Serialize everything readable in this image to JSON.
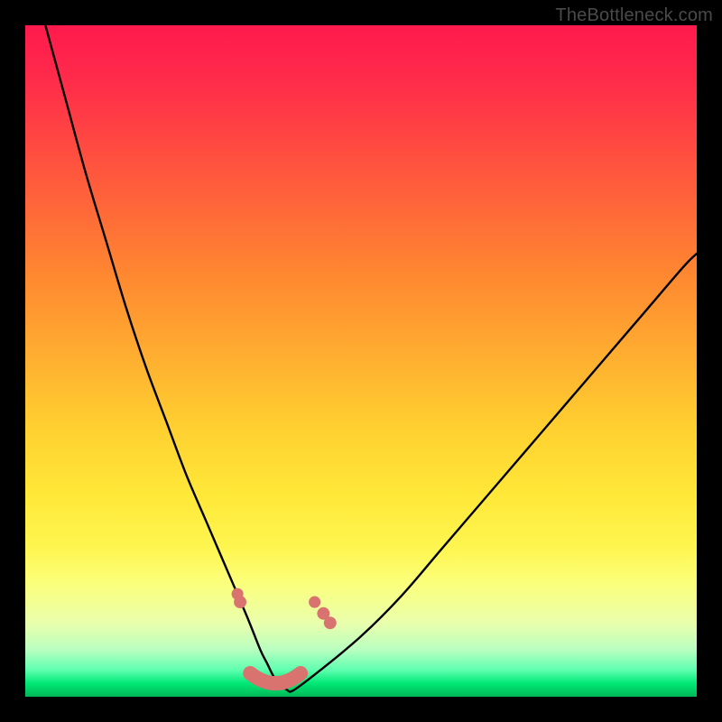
{
  "watermark": {
    "text": "TheBottleneck.com"
  },
  "colors": {
    "frame": "#000000",
    "curve": "#000000",
    "highlight_fill": "#d9736f",
    "highlight_stroke": "#d9736f",
    "gradient_top": "#ff1a4d",
    "gradient_bottom": "#00b857"
  },
  "chart_data": {
    "type": "line",
    "title": "",
    "xlabel": "",
    "ylabel": "",
    "xlim": [
      0,
      100
    ],
    "ylim": [
      0,
      100
    ],
    "grid": false,
    "legend": false,
    "series": [
      {
        "name": "bottleneck-curve",
        "x": [
          3,
          6,
          9,
          12,
          15,
          18,
          21,
          24,
          27,
          30,
          33,
          35,
          36,
          37,
          38,
          39,
          40,
          44,
          50,
          56,
          62,
          68,
          74,
          80,
          86,
          92,
          98,
          100
        ],
        "y": [
          100,
          89,
          78,
          68,
          58,
          49,
          41,
          33,
          26,
          19,
          12,
          7,
          5,
          3,
          2,
          1,
          1,
          4,
          9,
          15,
          22,
          29,
          36,
          43,
          50,
          57,
          64,
          66
        ]
      }
    ],
    "highlight_segments": [
      {
        "center_x": 31.6,
        "center_y": 15.3,
        "r": 1.6
      },
      {
        "center_x": 32.0,
        "center_y": 14.1,
        "r": 1.7
      },
      {
        "center_x": 43.1,
        "center_y": 14.1,
        "r": 1.6
      },
      {
        "center_x": 44.4,
        "center_y": 12.4,
        "r": 1.7
      },
      {
        "center_x": 45.4,
        "center_y": 11.0,
        "r": 1.7
      }
    ],
    "highlight_band": {
      "x_from": 33.5,
      "x_to": 41.0,
      "y_level": 1.5
    }
  }
}
